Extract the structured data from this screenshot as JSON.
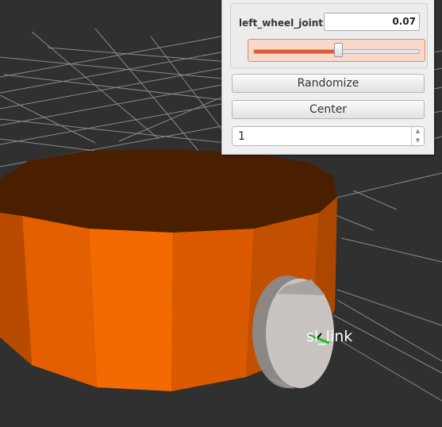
{
  "joint_panel": {
    "joint_name": "left_wheel_joint",
    "joint_value": "0.07",
    "slider_fraction": 0.51,
    "randomize_label": "Randomize",
    "center_label": "Center",
    "row_count": "1"
  },
  "viewport": {
    "frame_label": "sl_link",
    "colors": {
      "background": "#303030",
      "grid": "#a8a8a8",
      "base_top": "#4a1f00",
      "base_side_light": "#f26a00",
      "wheel": "#c9c4c1",
      "axis_green": "#18c018"
    }
  },
  "icons": {
    "spin_up": "chevron-up-icon",
    "spin_down": "chevron-down-icon"
  }
}
